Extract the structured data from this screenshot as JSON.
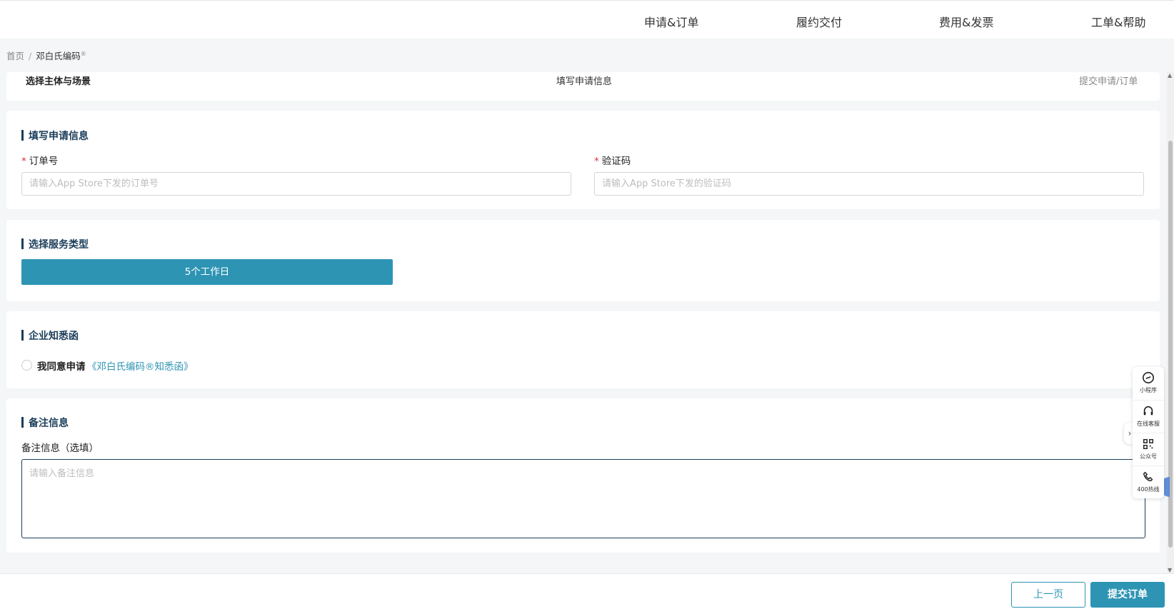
{
  "top_nav": {
    "items": [
      "申请&订单",
      "履约交付",
      "费用&发票",
      "工单&帮助"
    ]
  },
  "breadcrumb": {
    "home": "首页",
    "separator": "/",
    "current": "邓白氏编码",
    "current_mark": "®"
  },
  "steps": {
    "step1": "选择主体与场景",
    "step2": "填写申请信息",
    "step3": "提交申请/订单"
  },
  "application": {
    "title": "填写申请信息",
    "order_label": "订单号",
    "order_placeholder": "请输入App Store下发的订单号",
    "code_label": "验证码",
    "code_placeholder": "请输入App Store下发的验证码",
    "required_mark": "*"
  },
  "service": {
    "title": "选择服务类型",
    "option": "5个工作日"
  },
  "notice": {
    "title": "企业知悉函",
    "agree_text": "我同意申请",
    "link_text": "《邓白氏编码®知悉函》"
  },
  "remarks": {
    "title": "备注信息",
    "label": "备注信息（选填）",
    "placeholder": "请输入备注信息"
  },
  "footer": {
    "prev": "上一页",
    "submit": "提交订单"
  },
  "float_panel": {
    "items": [
      {
        "label": "小程序",
        "icon": "mini-program-icon"
      },
      {
        "label": "在线客服",
        "icon": "headset-icon"
      },
      {
        "label": "公众号",
        "icon": "qr-code-icon"
      },
      {
        "label": "400热线",
        "icon": "phone-icon"
      }
    ],
    "collapse": "›"
  },
  "colors": {
    "accent": "#2e94b4",
    "title": "#1b3d5a",
    "required": "#d9363e"
  }
}
